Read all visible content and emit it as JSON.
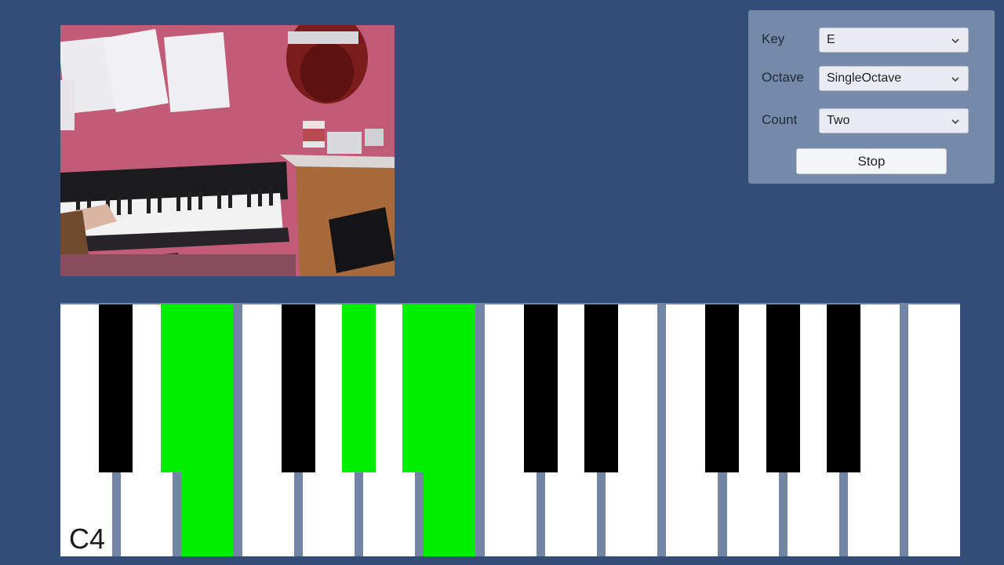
{
  "panel": {
    "key_label": "Key",
    "key_value": "E",
    "octave_label": "Octave",
    "octave_value": "SingleOctave",
    "count_label": "Count",
    "count_value": "Two",
    "stop_label": "Stop"
  },
  "keyboard": {
    "octave_label": "C4",
    "highlight_color": "#00ee00",
    "white_keys": [
      "C",
      "D",
      "E",
      "F",
      "G",
      "A",
      "B",
      "C",
      "D",
      "E",
      "F",
      "G",
      "A",
      "B",
      "C"
    ],
    "black_keys": [
      "C#",
      "D#",
      "F#",
      "G#",
      "A#",
      "C#",
      "D#",
      "F#",
      "G#",
      "A#"
    ],
    "highlighted_white": [
      "E",
      "B"
    ],
    "highlighted_black": [
      "D#",
      "G#",
      "A#"
    ]
  }
}
